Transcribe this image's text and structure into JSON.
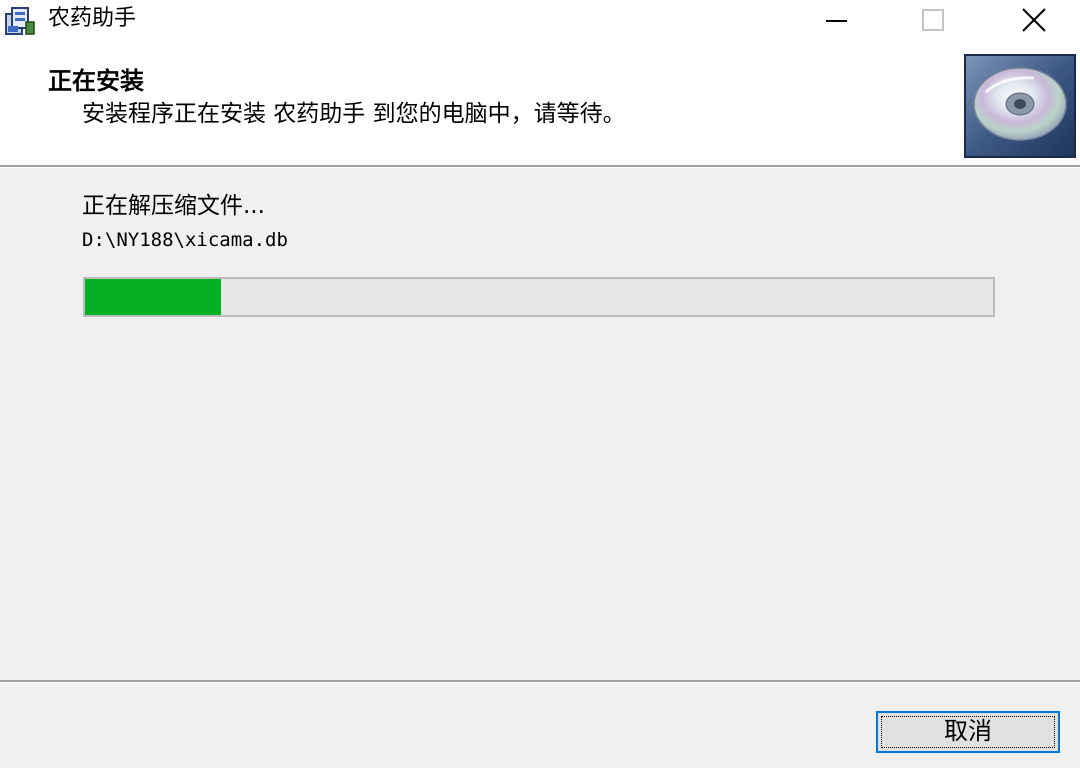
{
  "window": {
    "title": "农药助手",
    "icon": "installer-app-icon",
    "controls": [
      "minimize-icon",
      "maximize-icon",
      "close-icon"
    ]
  },
  "header": {
    "title": "正在安装",
    "subtitle": "安装程序正在安装 农药助手 到您的电脑中，请等待。",
    "image": "cd-disc-icon"
  },
  "body": {
    "status": "正在解压缩文件...",
    "current_file": "D:\\NY188\\xicama.db",
    "progress_fraction": 0.15
  },
  "footer": {
    "cancel_label": "取消"
  },
  "colors": {
    "progress_fill": "#06b025",
    "focus_border": "#0078d7",
    "header_bg": "#ffffff",
    "body_bg": "#f0f0f0"
  }
}
